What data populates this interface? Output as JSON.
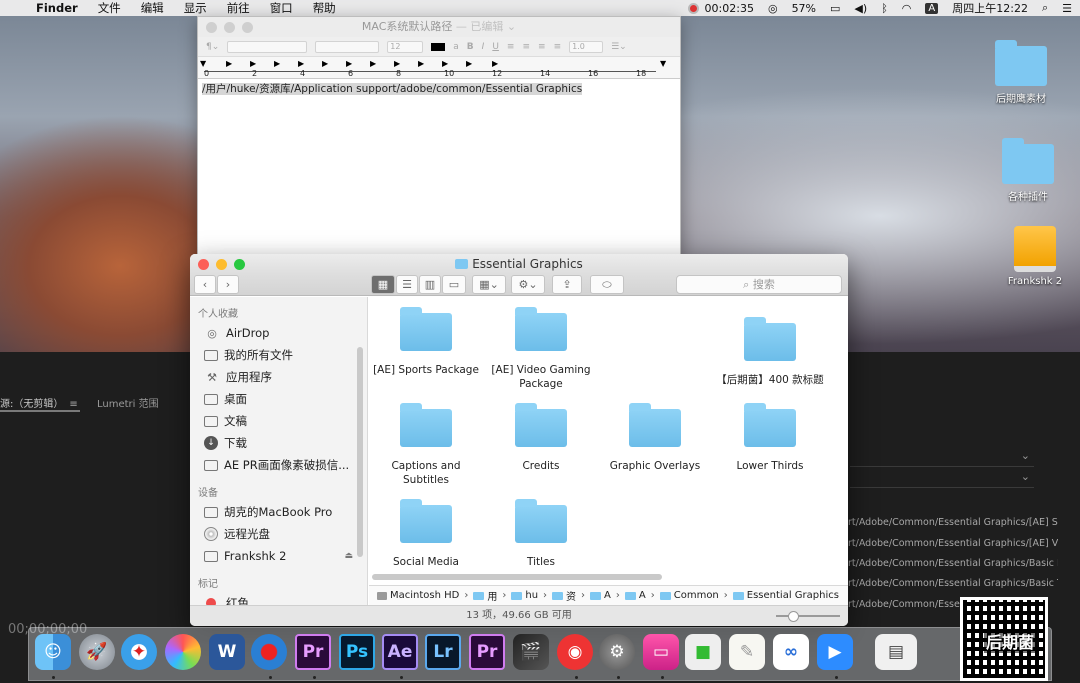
{
  "menubar": {
    "app": "Finder",
    "menus": [
      "文件",
      "编辑",
      "显示",
      "前往",
      "窗口",
      "帮助"
    ],
    "record_time": "00:02:35",
    "battery": "57%",
    "input_method": "A",
    "clock": "周四上午12:22"
  },
  "desktop": {
    "icons": [
      {
        "label": "后期鹰素材"
      },
      {
        "label": "各种插件"
      },
      {
        "label": "Frankshk 2"
      }
    ]
  },
  "textedit": {
    "title": "MAC系统默认路径",
    "title_suffix": "— 已编辑 ⌄",
    "font_size": "12",
    "line_spacing": "1.0",
    "ruler_numbers": [
      "0",
      "2",
      "4",
      "6",
      "8",
      "10",
      "12",
      "14",
      "16",
      "18"
    ],
    "body": "/用户/huke/资源库/Application support/adobe/common/Essential Graphics"
  },
  "finder": {
    "title": "Essential Graphics",
    "search_placeholder": "搜索",
    "sidebar": {
      "favorites_header": "个人收藏",
      "favorites": [
        "AirDrop",
        "我的所有文件",
        "应用程序",
        "桌面",
        "文稿",
        "下载",
        "AE PR画面像素破损信..."
      ],
      "devices_header": "设备",
      "devices": [
        "胡克的MacBook Pro",
        "远程光盘",
        "Frankshk 2"
      ],
      "tags_header": "标记",
      "tags": [
        "红色"
      ]
    },
    "items": [
      "[AE] Sports Package",
      "[AE] Video Gaming Package",
      "【后期菌】400 款标题",
      "Captions and Subtitles",
      "Credits",
      "Graphic Overlays",
      "Lower Thirds",
      "Social Media",
      "Titles"
    ],
    "path": [
      "Macintosh HD",
      "用",
      "hu",
      "资",
      "A",
      "A",
      "Common",
      "Essential Graphics"
    ],
    "status": "13 项，49.66 GB 可用"
  },
  "premiere": {
    "tab_source": "源:（无剪辑）",
    "tab_lumetri": "Lumetri 范围",
    "timecode": "00;00;00;00",
    "paths": [
      "rt/Adobe/Common/Essential Graphics/[AE] Sport",
      "rt/Adobe/Common/Essential Graphics/[AE] Videc",
      "rt/Adobe/Common/Essential Graphics/Basic Low",
      "rt/Adobe/Common/Essential Graphics/Basic Title",
      "rt/Adobe/Common/Essentl"
    ]
  },
  "dock": {
    "apps": [
      "Finder",
      "Launchpad",
      "Safari",
      "Photos",
      "Word",
      "Recorder",
      "Pr",
      "Ps",
      "Ae",
      "Lr",
      "Pr",
      "Final Cut Pro",
      "NetEase Music",
      "System Preferences",
      "Screen",
      "FaceTime",
      "Notes",
      "Baidu Netdisk",
      "Zoom",
      "Preview"
    ]
  },
  "watermark": "后期菌"
}
